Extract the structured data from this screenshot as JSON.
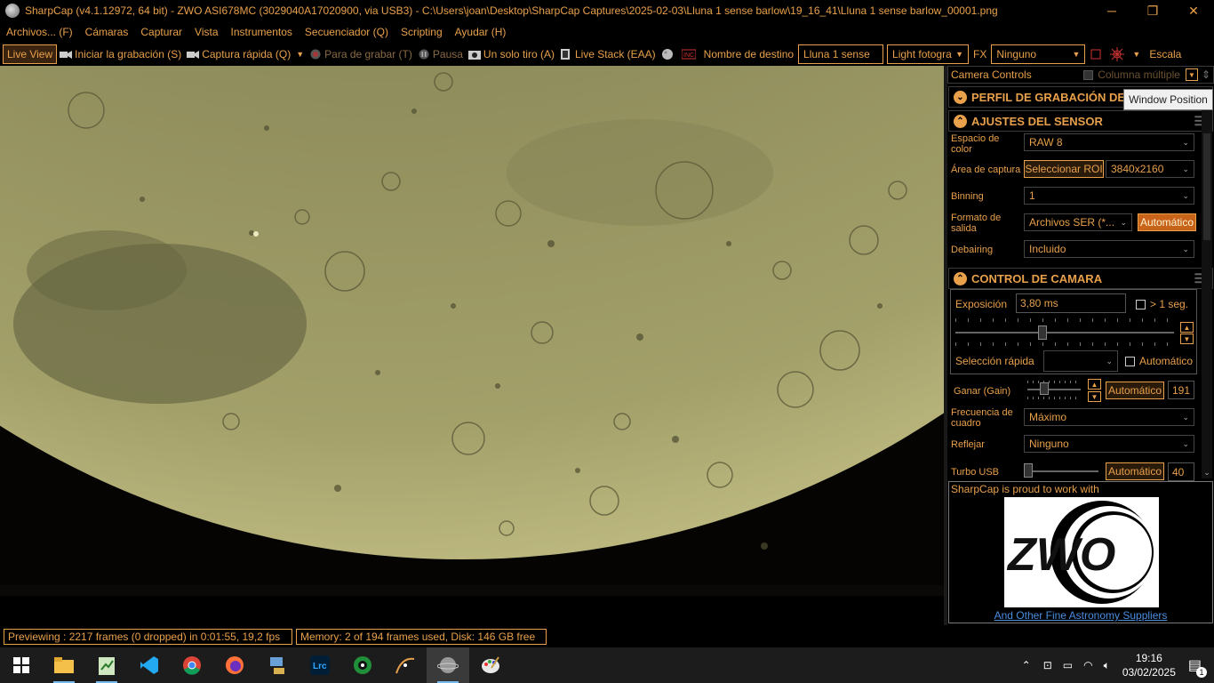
{
  "window": {
    "title": "SharpCap (v4.1.12972, 64 bit) - ZWO ASI678MC (3029040A17020900, via USB3) - C:\\Users\\joan\\Desktop\\SharpCap Captures\\2025-02-03\\Lluna 1 sense barlow\\19_16_41\\Lluna 1 sense barlow_00001.png",
    "minimize": "─",
    "maximize": "❐",
    "close": "✕"
  },
  "menu": [
    "Archivos... (F)",
    "Cámaras",
    "Capturar",
    "Vista",
    "Instrumentos",
    "Secuenciador (Q)",
    "Scripting",
    "Ayudar (H)"
  ],
  "toolbar": {
    "live_view": "Live View",
    "start_capture": "Iniciar la grabación (S)",
    "quick_capture": "Captura rápida (Q)",
    "stop_capture": "Para de grabar (T)",
    "pause": "Pausa",
    "single_shot": "Un solo tiro (A)",
    "live_stack": "Live Stack (EAA)",
    "target_name_label": "Nombre de destino",
    "target_name_value": "Lluna 1 sense",
    "frame_type": "Light fotogra",
    "fx_label": "FX",
    "fx_value": "Ninguno",
    "scale_label": "Escala"
  },
  "panel": {
    "title": "Camera Controls",
    "multi_column": "Columna múltiple",
    "profile_section": "PERFIL DE GRABACIÓN DE I",
    "tooltip": "Window Position",
    "sensor_section": "AJUSTES DEL SENSOR",
    "color_space_label": "Espacio de color",
    "color_space_value": "RAW 8",
    "capture_area_label": "Área de captura",
    "select_roi": "Seleccionar ROI",
    "resolution": "3840x2160",
    "binning_label": "Binning",
    "binning_value": "1",
    "output_format_label": "Formato de salida",
    "output_format_value": "Archivos SER (*...",
    "output_auto": "Automático",
    "debayer_label": "Debairing",
    "debayer_value": "Incluido",
    "camera_section": "CONTROL DE CAMARA",
    "exposure_label": "Exposición",
    "exposure_value": "3,80 ms",
    "exposure_long": "> 1 seg.",
    "quick_select_label": "Selección rápida",
    "quick_auto": "Automático",
    "gain_label": "Ganar (Gain)",
    "gain_auto": "Automático",
    "gain_value": "191",
    "frame_rate_label": "Frecuencia de cuadro",
    "frame_rate_value": "Máximo",
    "flip_label": "Reflejar",
    "flip_value": "Ninguno",
    "usb_label": "Turbo USB",
    "usb_auto": "Automático",
    "usb_value": "40"
  },
  "promo": {
    "text": "SharpCap is proud to work with",
    "logo": "ZWO",
    "link": "And Other Fine Astronomy Suppliers"
  },
  "status": {
    "preview": "Previewing : 2217 frames (0 dropped) in 0:01:55, 19,2 fps",
    "memory": "Memory: 2 of 194 frames used, Disk: 146 GB free"
  },
  "taskbar": {
    "apps": [
      "windows-start",
      "file-explorer",
      "notepad",
      "vscode",
      "chrome",
      "firefox",
      "network-app",
      "lightroom-classic",
      "sharpcap-helper",
      "stellarium",
      "sharpcap",
      "paint"
    ],
    "time": "19:16",
    "date": "03/02/2025",
    "notifications": "1"
  },
  "colors": {
    "accent": "#e8a04a",
    "moon": "#8a8a58"
  }
}
